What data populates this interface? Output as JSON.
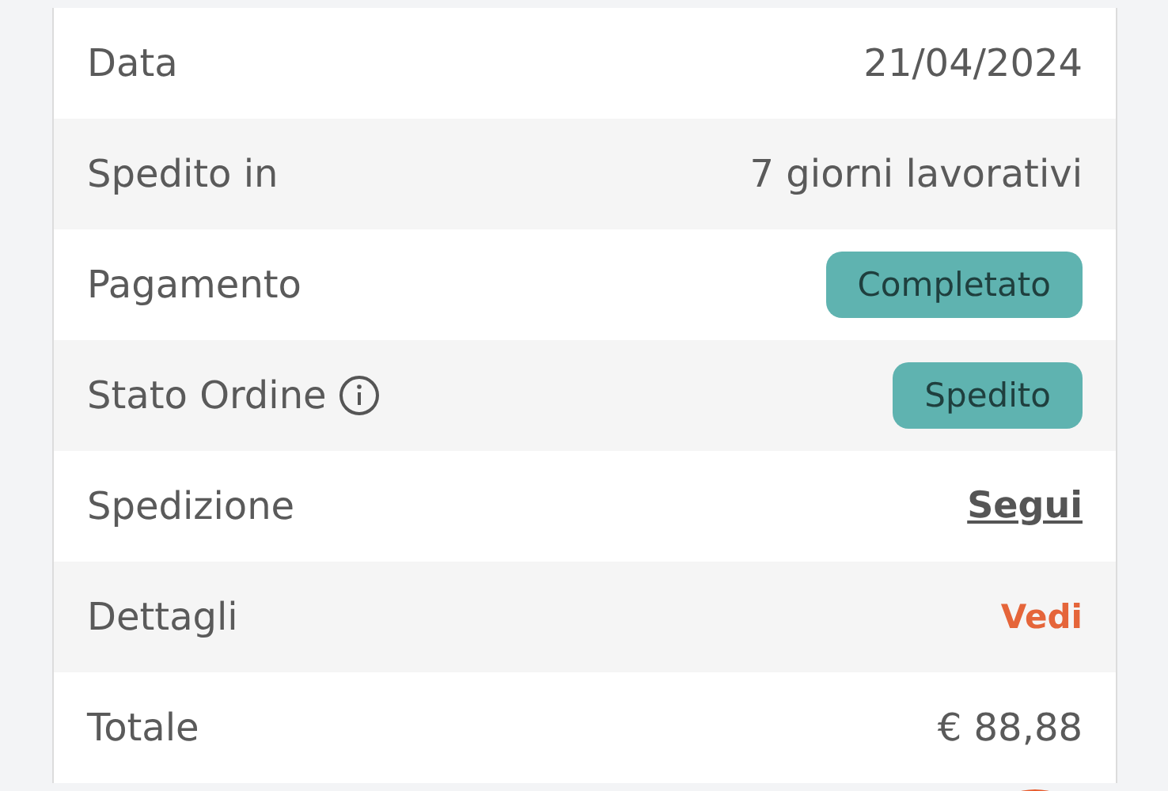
{
  "rows": [
    {
      "label": "Data",
      "kind": "text",
      "value": "21/04/2024"
    },
    {
      "label": "Spedito in",
      "kind": "text",
      "value": "7 giorni lavorativi"
    },
    {
      "label": "Pagamento",
      "kind": "badge",
      "value": "Completato"
    },
    {
      "label": "Stato Ordine",
      "info": true,
      "kind": "badge",
      "value": "Spedito"
    },
    {
      "label": "Spedizione",
      "kind": "link",
      "value": "Segui"
    },
    {
      "label": "Dettagli",
      "kind": "action",
      "value": "Vedi"
    },
    {
      "label": "Totale",
      "kind": "text",
      "value": "€ 88,88"
    }
  ]
}
